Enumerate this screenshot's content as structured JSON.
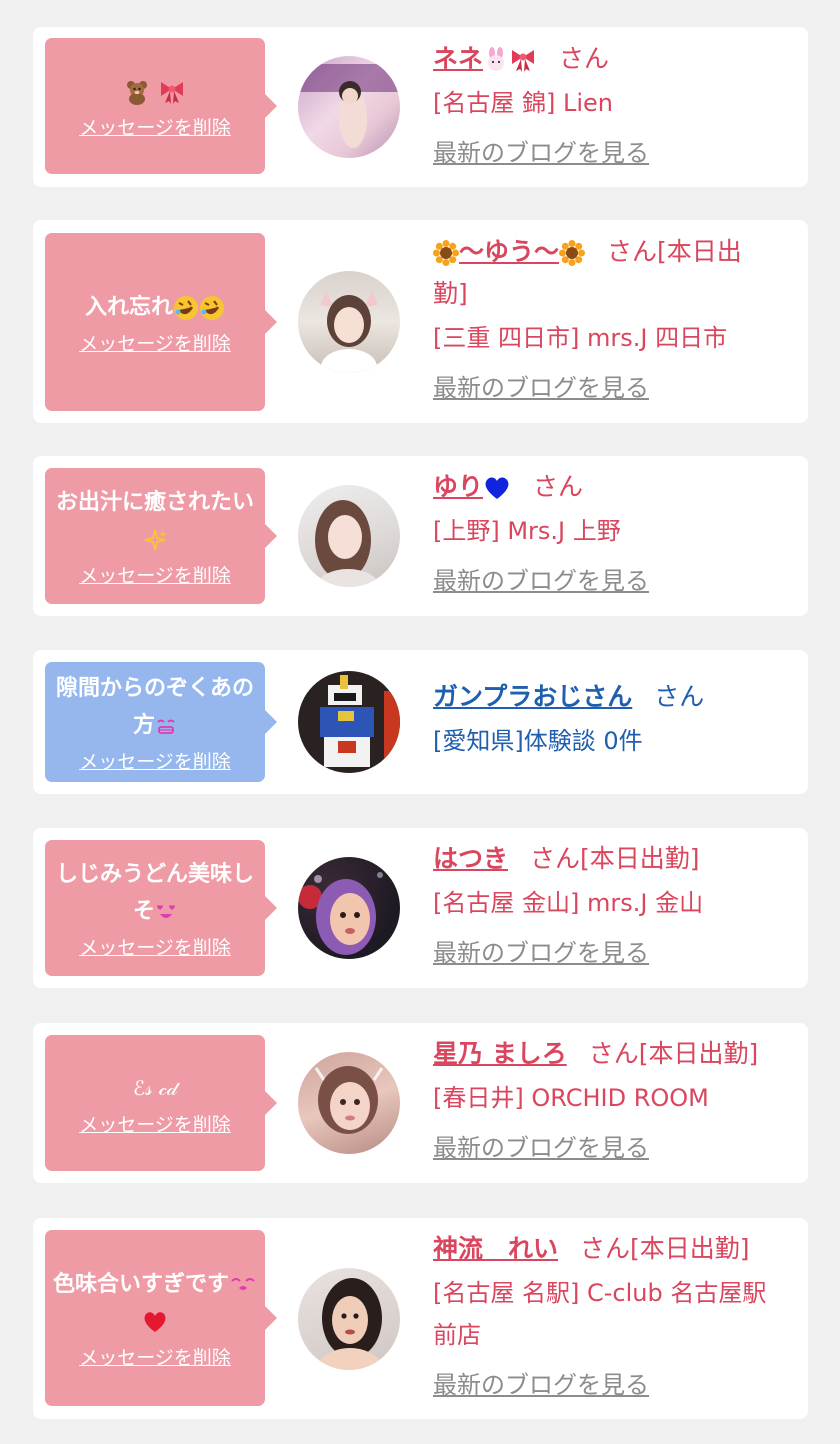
{
  "delete_label": "メッセージを削除",
  "blog_label": "最新のブログを見る",
  "colors": {
    "pink_bubble": "#ef9ba6",
    "blue_bubble": "#95b7ee",
    "pink_text": "#d9465e",
    "blue_text": "#1f5fb0",
    "link_gray": "#8c8c8c",
    "page_bg": "#f0f0f0"
  },
  "items": [
    {
      "message": "",
      "message_icons": [
        "teddy-bear-icon",
        "ribbon-icon"
      ],
      "name": "ネネ",
      "name_icons": [
        "rabbit-icon",
        "ribbon-icon"
      ],
      "suffix": "さん",
      "shop": "[名古屋 錦] Lien",
      "has_blog": true,
      "style": "pink"
    },
    {
      "message": "入れ忘れ",
      "message_icons": [
        "rofl-emoji-icon",
        "rofl-emoji-icon"
      ],
      "name": "〜ゆう〜",
      "name_icons": [
        "sunflower-icon",
        "sunflower-icon"
      ],
      "suffix": "さん[本日出勤]",
      "shop": "[三重 四日市] mrs.J 四日市",
      "has_blog": true,
      "style": "pink"
    },
    {
      "message": "お出汁に癒されたい",
      "message_icons": [
        "sparkles-icon"
      ],
      "name": "ゆり",
      "name_icons": [
        "blue-heart-icon"
      ],
      "suffix": "さん",
      "shop": "[上野] Mrs.J 上野",
      "has_blog": true,
      "style": "pink"
    },
    {
      "message": "隙間からのぞくあの方",
      "message_icons": [
        "grin-face-icon"
      ],
      "name": "ガンプラおじさん",
      "name_icons": [],
      "suffix": "さん",
      "shop": "[愛知県]体験談 0件",
      "has_blog": false,
      "style": "blue"
    },
    {
      "message": "しじみうどん美味しそ",
      "message_icons": [
        "heart-eyes-face-icon"
      ],
      "name": "はつき",
      "name_icons": [],
      "suffix": "さん[本日出勤]",
      "shop": "[名古屋 金山] mrs.J 金山",
      "has_blog": true,
      "style": "pink"
    },
    {
      "message": "ℰ𝓈 𝒸𝒹",
      "message_icons": [],
      "name": "星乃 ましろ",
      "name_icons": [],
      "suffix": "さん[本日出勤]",
      "shop": "[春日井] ORCHID ROOM",
      "has_blog": true,
      "style": "pink"
    },
    {
      "message": "色味合いすぎです",
      "message_icons": [
        "kiss-face-icon",
        "red-heart-icon"
      ],
      "name": "神流　れい",
      "name_icons": [],
      "suffix": "さん[本日出勤]",
      "shop": "[名古屋 名駅] C-club 名古屋駅前店",
      "has_blog": true,
      "style": "pink"
    }
  ]
}
